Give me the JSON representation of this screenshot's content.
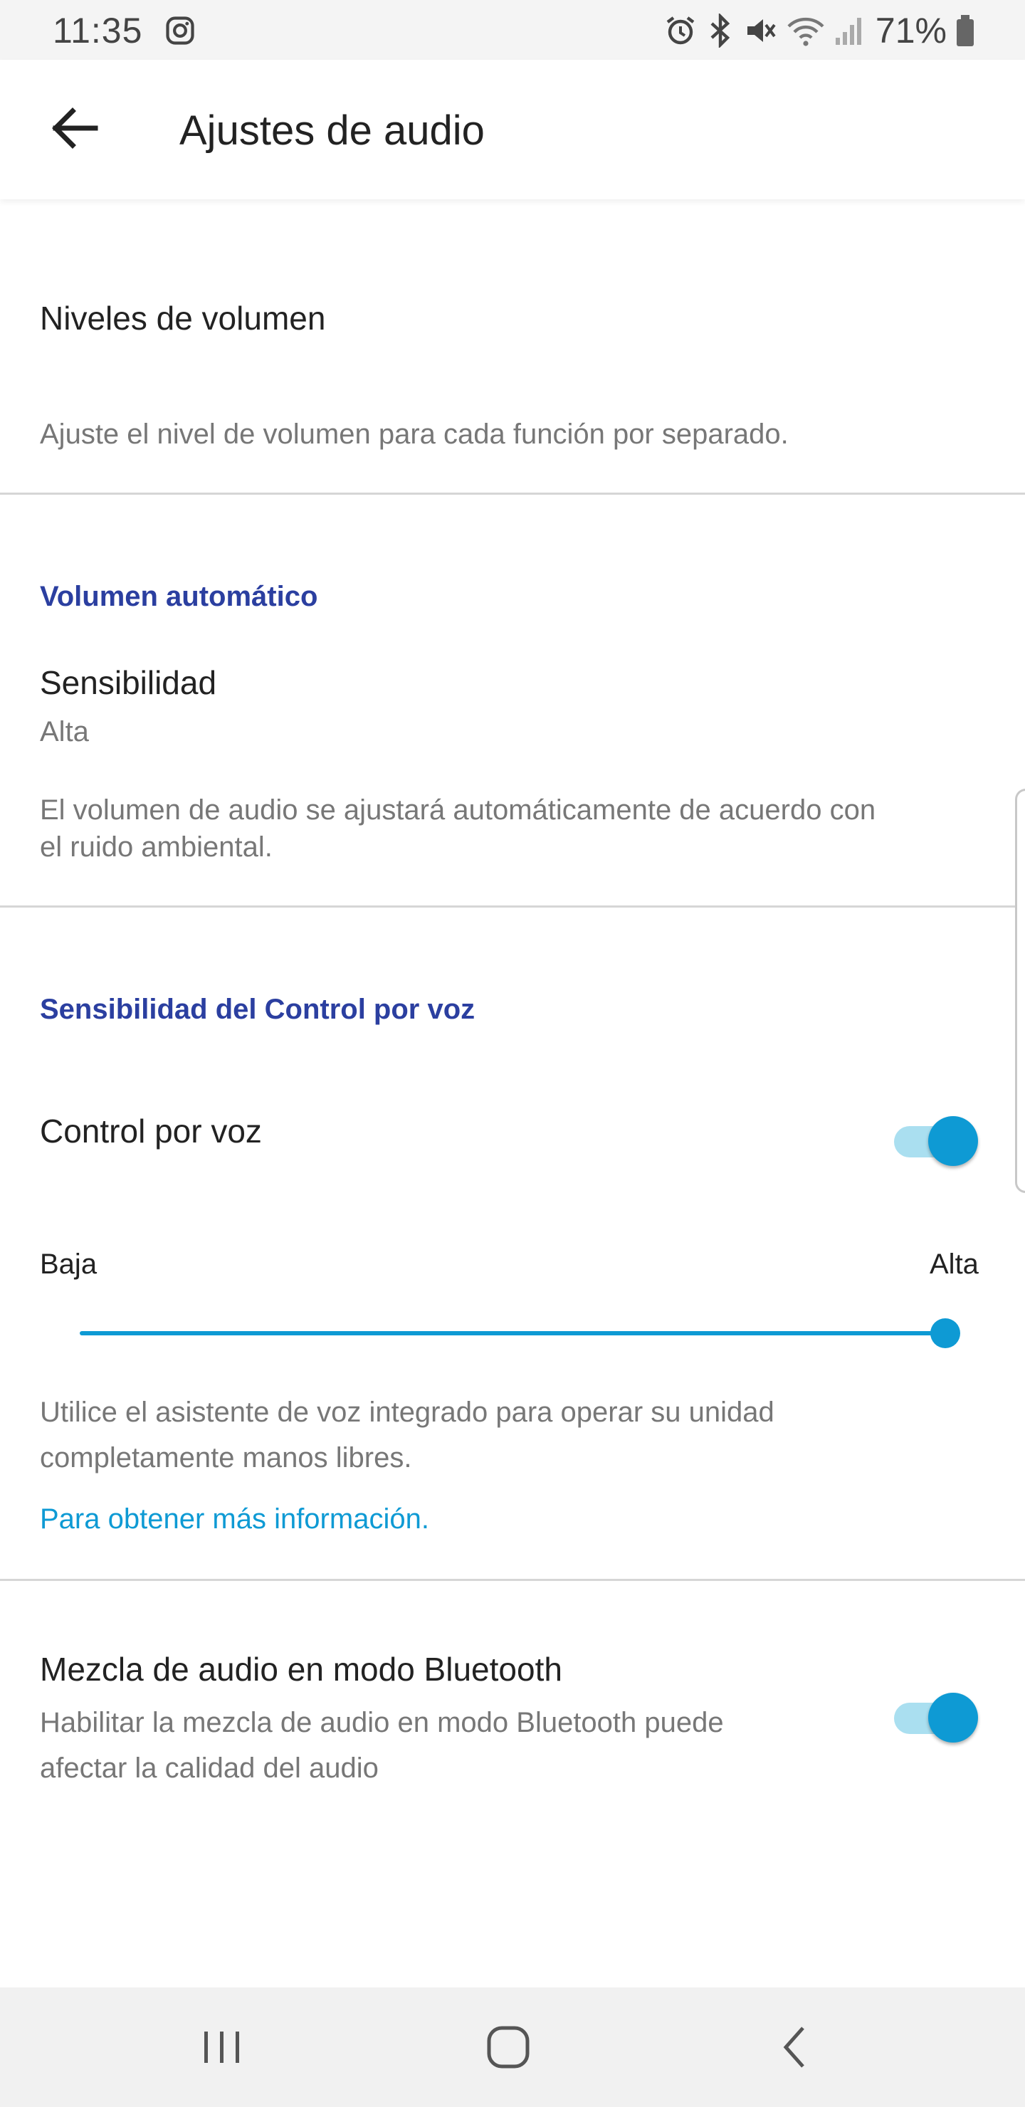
{
  "status_bar": {
    "time": "11:35",
    "battery": "71%",
    "icons": [
      "instagram-icon",
      "alarm-icon",
      "bluetooth-icon",
      "mute-icon",
      "wifi-icon",
      "signal-icon",
      "battery-icon"
    ]
  },
  "header": {
    "title": "Ajustes de audio",
    "back_icon": "arrow-left-icon"
  },
  "volume_levels": {
    "title": "Niveles de volumen",
    "description": "Ajuste el nivel de volumen para cada función por separado."
  },
  "auto_volume": {
    "heading": "Volumen automático",
    "sensitivity_label": "Sensibilidad",
    "sensitivity_value": "Alta",
    "description_line1": "El volumen de audio se ajustará automáticamente de acuerdo con",
    "description_line2": "el ruido ambiental."
  },
  "voice_control": {
    "heading": "Sensibilidad del Control por voz",
    "toggle_label": "Control por voz",
    "toggle_on": true,
    "slider_min_label": "Baja",
    "slider_max_label": "Alta",
    "slider_value": 1.0,
    "description_line1": "Utilice el asistente de voz integrado para operar su unidad",
    "description_line2": "completamente manos libres.",
    "link": "Para obtener más información."
  },
  "bluetooth_mix": {
    "title": "Mezcla de audio en modo Bluetooth",
    "description_line1": "Habilitar la mezcla de audio en modo Bluetooth puede",
    "description_line2": "afectar la calidad del audio",
    "toggle_on": true
  },
  "nav_bar": {
    "icons": [
      "recent-apps-icon",
      "home-icon",
      "back-icon"
    ]
  },
  "colors": {
    "accent": "#0e9ad4",
    "section_heading": "#2b3fa0",
    "toggle_track": "#aadff0"
  }
}
